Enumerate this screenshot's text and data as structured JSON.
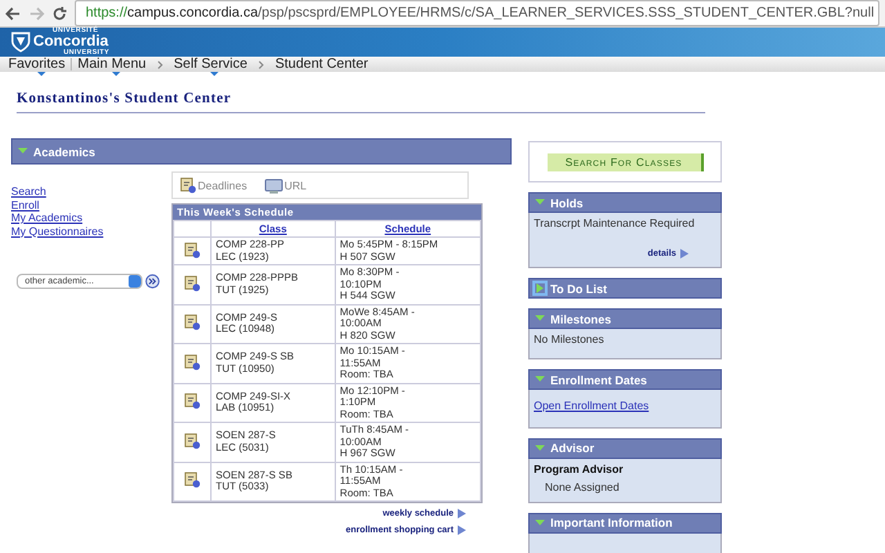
{
  "browser": {
    "url_secure": "https://",
    "url_host": "campus.concordia.ca",
    "url_path": "/psp/pscsprd/EMPLOYEE/HRMS/c/SA_LEARNER_SERVICES.SSS_STUDENT_CENTER.GBL?null"
  },
  "header": {
    "logo_top": "UNIVERSITÉ",
    "logo_name": "Concordia",
    "logo_bottom": "UNIVERSITY"
  },
  "nav": [
    {
      "label": "Favorites",
      "kind": "menu"
    },
    {
      "label": "Main Menu",
      "kind": "menu"
    },
    {
      "label": "Self Service",
      "kind": "menu"
    },
    {
      "label": "Student Center",
      "kind": "page"
    }
  ],
  "page_title": "Konstantinos's Student Center",
  "academics": {
    "title": "Academics",
    "expanded": true,
    "links": [
      "Search",
      "Enroll",
      "My Academics",
      "My Questionnaires"
    ],
    "select": {
      "value": "other academic..."
    },
    "tabs": [
      {
        "label": "Deadlines",
        "kind": "calendar"
      },
      {
        "label": "URL",
        "kind": "screen"
      }
    ],
    "schedule": {
      "title": "This Week's Schedule",
      "columns": [
        "Class",
        "Schedule"
      ],
      "rows": [
        {
          "class": [
            "COMP 228-PP",
            "LEC (1923)"
          ],
          "schedule": [
            "Mo 5:45PM - 8:15PM",
            "H 507 SGW"
          ]
        },
        {
          "class": [
            "COMP 228-PPPB",
            "TUT (1925)"
          ],
          "schedule": [
            "Mo 8:30PM -",
            "10:10PM",
            "H 544 SGW"
          ]
        },
        {
          "class": [
            "COMP 249-S",
            "LEC (10948)"
          ],
          "schedule": [
            "MoWe 8:45AM -",
            "10:00AM",
            "H 820 SGW"
          ]
        },
        {
          "class": [
            "COMP 249-S SB",
            "TUT (10950)"
          ],
          "schedule": [
            "Mo 10:15AM -",
            "11:55AM",
            "Room:  TBA"
          ]
        },
        {
          "class": [
            "COMP 249-SI-X",
            "LAB (10951)"
          ],
          "schedule": [
            "Mo 12:10PM -",
            "1:10PM",
            "Room:  TBA"
          ]
        },
        {
          "class": [
            "SOEN 287-S",
            "LEC (5031)"
          ],
          "schedule": [
            "TuTh 8:45AM -",
            "10:00AM",
            "H 967 SGW"
          ]
        },
        {
          "class": [
            "SOEN 287-S SB",
            "TUT (5033)"
          ],
          "schedule": [
            "Th 10:15AM -",
            "11:55AM",
            "Room:  TBA"
          ]
        }
      ]
    },
    "footer_links": [
      "weekly schedule",
      "enrollment shopping cart"
    ]
  },
  "search_button": "Search For Classes",
  "panels": [
    {
      "title": "Holds",
      "expanded": true,
      "items": [
        {
          "kind": "text",
          "text": "Transcrpt Maintenance Required"
        },
        {
          "kind": "more",
          "text": "details"
        }
      ]
    },
    {
      "title": "To Do List",
      "expanded": false
    },
    {
      "title": "Milestones",
      "expanded": true,
      "items": [
        {
          "kind": "text",
          "text": "No Milestones"
        }
      ]
    },
    {
      "title": "Enrollment Dates",
      "expanded": true,
      "items": [
        {
          "kind": "link",
          "text": "Open Enrollment Dates"
        }
      ]
    },
    {
      "title": "Advisor",
      "expanded": true,
      "items": [
        {
          "kind": "label",
          "text": "Program Advisor"
        },
        {
          "kind": "text",
          "text": "None Assigned"
        }
      ]
    },
    {
      "title": "Important Information",
      "expanded": true
    }
  ]
}
